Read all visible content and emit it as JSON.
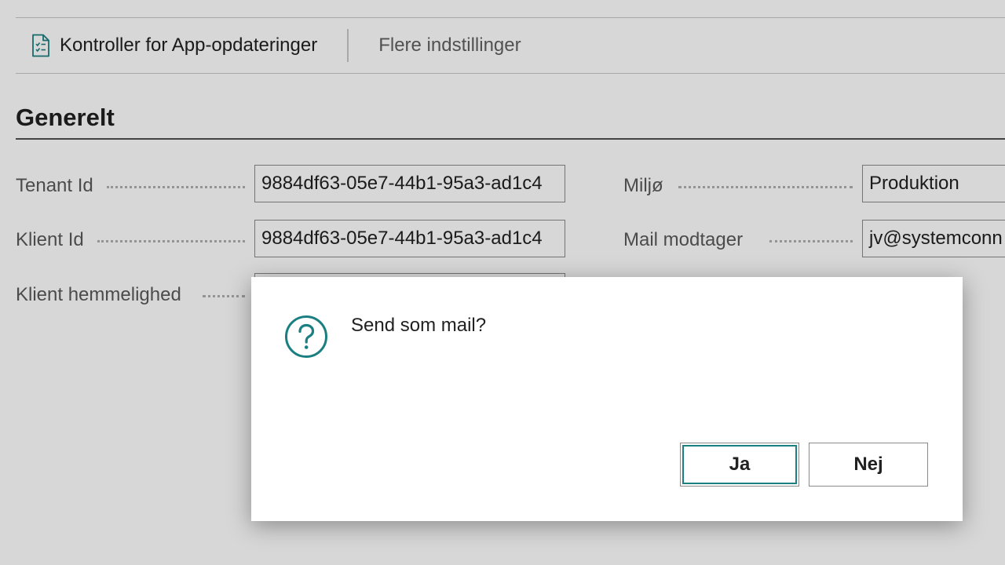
{
  "actionbar": {
    "check_updates_label": "Kontroller for App-opdateringer",
    "more_settings_label": "Flere indstillinger"
  },
  "section": {
    "title": "Generelt"
  },
  "fields": {
    "tenant_id": {
      "label": "Tenant Id",
      "value": "9884df63-05e7-44b1-95a3-ad1c4"
    },
    "client_id": {
      "label": "Klient Id",
      "value": "9884df63-05e7-44b1-95a3-ad1c4"
    },
    "client_secret": {
      "label": "Klient hemmelighed",
      "value": ""
    },
    "environment": {
      "label": "Miljø",
      "value": "Produktion"
    },
    "mail_recipient": {
      "label": "Mail modtager",
      "value": "jv@systemconn"
    }
  },
  "dialog": {
    "message": "Send som mail?",
    "yes_label": "Ja",
    "no_label": "Nej",
    "icon": "question-circle-icon",
    "accent_color": "#1a7f80"
  },
  "colors": {
    "accent": "#1a7f80",
    "text": "#212121",
    "label": "#5a5a5a"
  }
}
